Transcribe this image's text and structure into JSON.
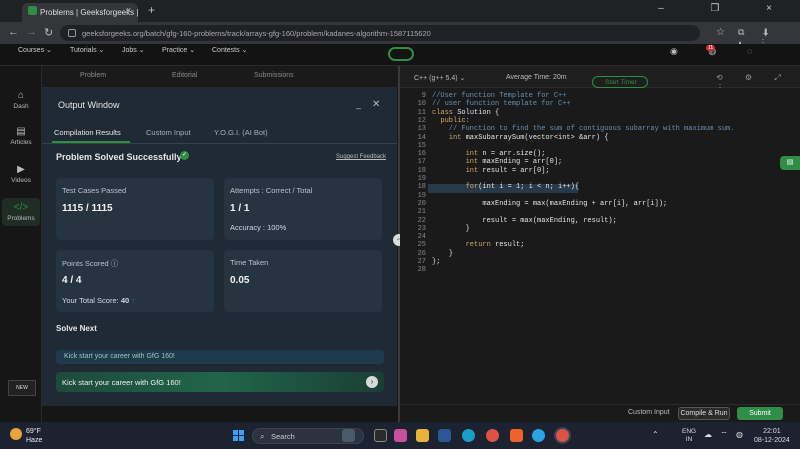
{
  "browser": {
    "tab_title": "Problems | Geeksforgeeks | ...",
    "tab_close": "×",
    "new_tab": "+",
    "window_controls": "– ❐ ×",
    "url": "geeksforgeeks.org/batch/gfg-160-problems/track/arrays-gfg-160/problem/kadanes-algorithm-1587115620",
    "nav_back": "←",
    "nav_forward": "→",
    "nav_reload": "↻",
    "bookmark": "☆",
    "extensions": "⧉ ⬇ ◐ ⋮"
  },
  "sitenav": {
    "items": [
      "Courses",
      "Tutorials",
      "Jobs",
      "Practice",
      "Contests"
    ],
    "right_icons": "◉ ◍ ◌",
    "notif_count": "11"
  },
  "sidebar": {
    "items": [
      {
        "icon": "⌂",
        "label": "Dash"
      },
      {
        "icon": "▤",
        "label": "Articles"
      },
      {
        "icon": "▶",
        "label": "Videos"
      },
      {
        "icon": "</>",
        "label": "Problems"
      }
    ],
    "bottom_label": "NEW"
  },
  "problem_tabs": [
    "Problem",
    "Editorial",
    "Submissions"
  ],
  "output": {
    "title": "Output Window",
    "min": "_",
    "close": "✕",
    "tabs": [
      "Compilation Results",
      "Custom Input",
      "Y.O.G.I. (AI Bot)"
    ],
    "solved_title": "Problem Solved Successfully",
    "suggest_feedback": "Suggest Feedback",
    "test_cases_label": "Test Cases Passed",
    "test_cases_value": "1115 / 1115",
    "attempts_label": "Attempts : Correct / Total",
    "attempts_value": "1 / 1",
    "accuracy": "Accuracy : 100%",
    "points_label": "Points Scored",
    "points_value": "4 / 4",
    "total_score_label": "Your Total Score:",
    "total_score_value": "40",
    "time_label": "Time Taken",
    "time_value": "0.05",
    "next_title": "Solve Next",
    "next_banner1": "Kick start your career with GfG 160!",
    "next_banner2": "Kick start your career with GfG 160!"
  },
  "editor": {
    "language": "C++ (g++ 5.4)",
    "avg_time": "Average Time: 20m",
    "start_timer": "Start Timer",
    "tools": "⟲ ⚙ ⤢ ⋮",
    "lines": [
      {
        "n": "9",
        "parts": [
          {
            "c": "cm",
            "t": "//User function Template for C++"
          }
        ]
      },
      {
        "n": "10",
        "parts": [
          {
            "c": "cm",
            "t": "// user function template for C++"
          }
        ]
      },
      {
        "n": "11",
        "parts": [
          {
            "c": "kw",
            "t": "class "
          },
          {
            "c": "tx",
            "t": "Solution {"
          }
        ]
      },
      {
        "n": "12",
        "parts": [
          {
            "c": "kw",
            "t": "  public:"
          }
        ]
      },
      {
        "n": "13",
        "parts": [
          {
            "c": "cm",
            "t": "    // Function to find the sum of contiguous subarray with maximum sum."
          }
        ]
      },
      {
        "n": "14",
        "parts": [
          {
            "c": "ty",
            "t": "    int "
          },
          {
            "c": "tx",
            "t": "maxSubarraySum(vector<int> &arr) {"
          }
        ]
      },
      {
        "n": "15",
        "parts": [
          {
            "c": "tx",
            "t": ""
          }
        ]
      },
      {
        "n": "16",
        "parts": [
          {
            "c": "ty",
            "t": "        int "
          },
          {
            "c": "tx",
            "t": "n = arr.size();"
          }
        ]
      },
      {
        "n": "17",
        "parts": [
          {
            "c": "ty",
            "t": "        int "
          },
          {
            "c": "tx",
            "t": "maxEnding = arr[0];"
          }
        ]
      },
      {
        "n": "18",
        "parts": [
          {
            "c": "ty",
            "t": "        int "
          },
          {
            "c": "tx",
            "t": "result = arr[0];"
          }
        ]
      },
      {
        "n": "19",
        "parts": [
          {
            "c": "tx",
            "t": ""
          }
        ]
      },
      {
        "n": "18",
        "parts": [
          {
            "c": "kw",
            "t": "        for"
          },
          {
            "c": "tx",
            "t": "(int i = 1; i < n; i++){"
          }
        ]
      },
      {
        "n": "19",
        "parts": [
          {
            "c": "tx",
            "t": ""
          }
        ]
      },
      {
        "n": "20",
        "parts": [
          {
            "c": "tx",
            "t": "            maxEnding = max(maxEnding + arr[i], arr[i]);"
          }
        ]
      },
      {
        "n": "21",
        "parts": [
          {
            "c": "tx",
            "t": ""
          }
        ]
      },
      {
        "n": "22",
        "parts": [
          {
            "c": "tx",
            "t": "            result = max(maxEnding, result);"
          }
        ]
      },
      {
        "n": "23",
        "parts": [
          {
            "c": "tx",
            "t": "        }"
          }
        ]
      },
      {
        "n": "24",
        "parts": [
          {
            "c": "tx",
            "t": ""
          }
        ]
      },
      {
        "n": "25",
        "parts": [
          {
            "c": "kw",
            "t": "        return "
          },
          {
            "c": "tx",
            "t": "result;"
          }
        ]
      },
      {
        "n": "26",
        "parts": [
          {
            "c": "tx",
            "t": "    }"
          }
        ]
      },
      {
        "n": "27",
        "parts": [
          {
            "c": "tx",
            "t": "};"
          }
        ]
      },
      {
        "n": "28",
        "parts": [
          {
            "c": "tx",
            "t": ""
          }
        ]
      }
    ],
    "btn_custom": "Custom Input",
    "btn_compile": "Compile & Run",
    "btn_submit": "Submit"
  },
  "taskbar": {
    "weather_temp": "69°F",
    "weather_desc": "Haze",
    "search": "Search",
    "lang": "ENG",
    "lang_region": "IN",
    "tray_up": "⌃",
    "tray_icons": "☁ ⌔ ◍",
    "time": "22:01",
    "date": "08-12-2024"
  },
  "colors": {
    "accent": "#2f8d46",
    "output_bg": "#1f2a35",
    "card_bg": "#263442",
    "keyword": "#d2a95e",
    "comment": "#6a8fb2"
  }
}
